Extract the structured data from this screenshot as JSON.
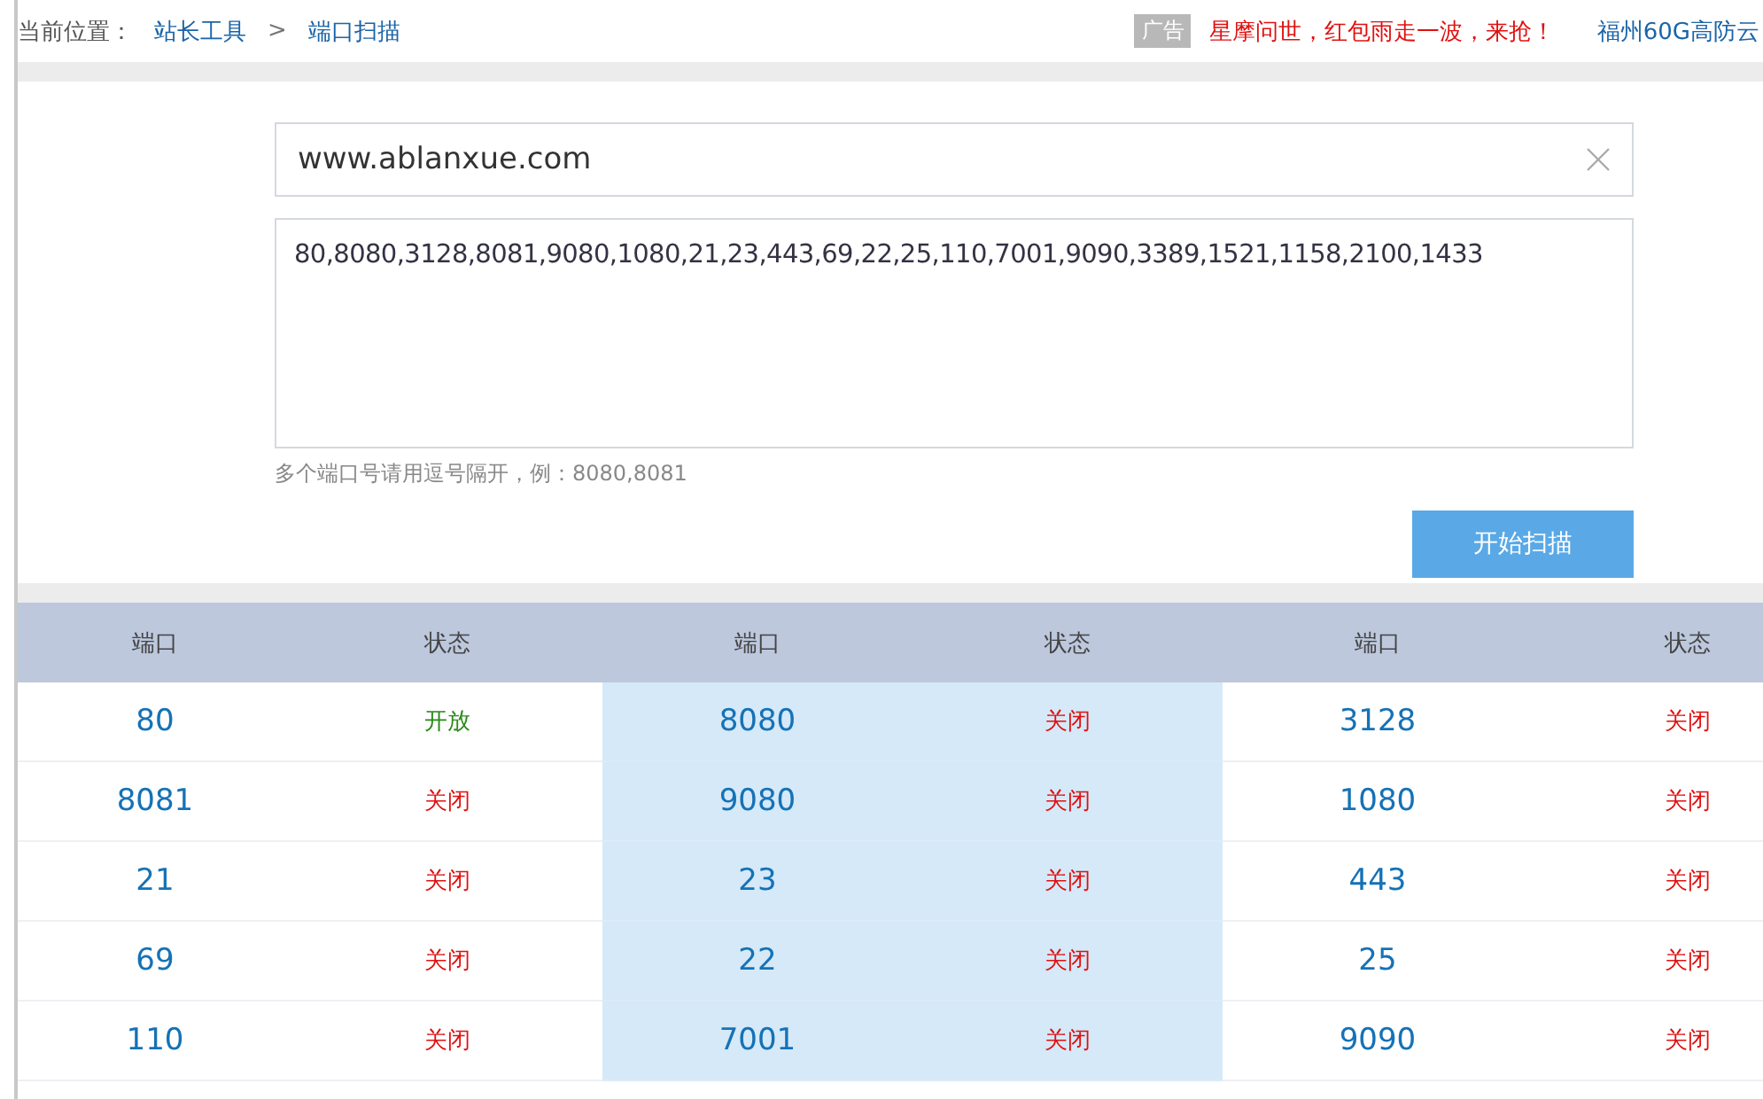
{
  "breadcrumb": {
    "label": "当前位置：",
    "items": [
      {
        "text": "站长工具"
      },
      {
        "text": "端口扫描"
      }
    ],
    "separator": ">"
  },
  "ads": {
    "tag": "广告",
    "items": [
      {
        "text": "星摩问世，红包雨走一波，来抢！",
        "kind": "highlight"
      },
      {
        "text": "福州60G高防云",
        "kind": "link"
      }
    ]
  },
  "form": {
    "host": {
      "value": "www.ablanxue.com"
    },
    "ports": {
      "value": "80,8080,3128,8081,9080,1080,21,23,443,69,22,25,110,7001,9090,3389,1521,1158,2100,1433"
    },
    "hint": "多个端口号请用逗号隔开，例：8080,8081",
    "submit": "开始扫描"
  },
  "table": {
    "columns": [
      "端口",
      "状态",
      "端口",
      "状态",
      "端口",
      "状态"
    ],
    "rows": [
      [
        {
          "text": "80",
          "kind": "port"
        },
        {
          "text": "开放",
          "kind": "status",
          "open": true
        },
        {
          "text": "8080",
          "kind": "port"
        },
        {
          "text": "关闭",
          "kind": "status",
          "open": false
        },
        {
          "text": "3128",
          "kind": "port"
        },
        {
          "text": "关闭",
          "kind": "status",
          "open": false
        }
      ],
      [
        {
          "text": "8081",
          "kind": "port"
        },
        {
          "text": "关闭",
          "kind": "status",
          "open": false
        },
        {
          "text": "9080",
          "kind": "port"
        },
        {
          "text": "关闭",
          "kind": "status",
          "open": false
        },
        {
          "text": "1080",
          "kind": "port"
        },
        {
          "text": "关闭",
          "kind": "status",
          "open": false
        }
      ],
      [
        {
          "text": "21",
          "kind": "port"
        },
        {
          "text": "关闭",
          "kind": "status",
          "open": false
        },
        {
          "text": "23",
          "kind": "port"
        },
        {
          "text": "关闭",
          "kind": "status",
          "open": false
        },
        {
          "text": "443",
          "kind": "port"
        },
        {
          "text": "关闭",
          "kind": "status",
          "open": false
        }
      ],
      [
        {
          "text": "69",
          "kind": "port"
        },
        {
          "text": "关闭",
          "kind": "status",
          "open": false
        },
        {
          "text": "22",
          "kind": "port"
        },
        {
          "text": "关闭",
          "kind": "status",
          "open": false
        },
        {
          "text": "25",
          "kind": "port"
        },
        {
          "text": "关闭",
          "kind": "status",
          "open": false
        }
      ],
      [
        {
          "text": "110",
          "kind": "port"
        },
        {
          "text": "关闭",
          "kind": "status",
          "open": false
        },
        {
          "text": "7001",
          "kind": "port"
        },
        {
          "text": "关闭",
          "kind": "status",
          "open": false
        },
        {
          "text": "9090",
          "kind": "port"
        },
        {
          "text": "关闭",
          "kind": "status",
          "open": false
        }
      ]
    ]
  }
}
